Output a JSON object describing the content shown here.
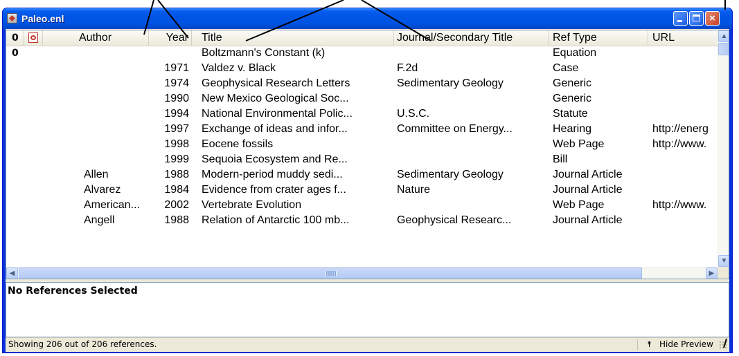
{
  "window": {
    "title": "Paleo.enl",
    "icon": "endnote-library-icon",
    "controls": {
      "minimize": "minimize",
      "maximize": "maximize",
      "close": "close"
    }
  },
  "columns": {
    "attachment_icon": "paperclip-icon",
    "attachment_glyph": "0",
    "pdf_icon": "pdf-icon",
    "author": "Author",
    "year": "Year",
    "title": "Title",
    "journal": "Journal/Secondary Title",
    "ref_type": "Ref Type",
    "url": "URL"
  },
  "rows": [
    {
      "attach": "0",
      "author": "",
      "year": "",
      "title": "Boltzmann's Constant (k)",
      "journal": "",
      "ref_type": "Equation",
      "url": ""
    },
    {
      "attach": "",
      "author": "",
      "year": "1971",
      "title": "Valdez v. Black",
      "journal": "F.2d",
      "ref_type": "Case",
      "url": ""
    },
    {
      "attach": "",
      "author": "",
      "year": "1974",
      "title": "Geophysical Research Letters",
      "journal": "Sedimentary Geology",
      "ref_type": "Generic",
      "url": ""
    },
    {
      "attach": "",
      "author": "",
      "year": "1990",
      "title": "New Mexico Geological Soc...",
      "journal": "",
      "ref_type": "Generic",
      "url": ""
    },
    {
      "attach": "",
      "author": "",
      "year": "1994",
      "title": "National Environmental Polic...",
      "journal": "U.S.C.",
      "ref_type": "Statute",
      "url": ""
    },
    {
      "attach": "",
      "author": "",
      "year": "1997",
      "title": "Exchange of ideas and infor...",
      "journal": "Committee on Energy...",
      "ref_type": "Hearing",
      "url": "http://energ"
    },
    {
      "attach": "",
      "author": "",
      "year": "1998",
      "title": "Eocene fossils",
      "journal": "",
      "ref_type": "Web Page",
      "url": "http://www."
    },
    {
      "attach": "",
      "author": "",
      "year": "1999",
      "title": "Sequoia Ecosystem and Re...",
      "journal": "",
      "ref_type": "Bill",
      "url": ""
    },
    {
      "attach": "",
      "author": "Allen",
      "year": "1988",
      "title": "Modern-period muddy sedi...",
      "journal": "Sedimentary Geology",
      "ref_type": "Journal Article",
      "url": ""
    },
    {
      "attach": "",
      "author": "Alvarez",
      "year": "1984",
      "title": "Evidence from crater ages f...",
      "journal": "Nature",
      "ref_type": "Journal Article",
      "url": ""
    },
    {
      "attach": "",
      "author": "American...",
      "year": "2002",
      "title": "Vertebrate Evolution",
      "journal": "",
      "ref_type": "Web Page",
      "url": "http://www."
    },
    {
      "attach": "",
      "author": "Angell",
      "year": "1988",
      "title": "Relation of Antarctic 100 mb...",
      "journal": "Geophysical Researc...",
      "ref_type": "Journal Article",
      "url": ""
    }
  ],
  "scrollbars": {
    "up": "▲",
    "down": "▼",
    "left": "◀",
    "right": "▶"
  },
  "preview": {
    "text": "No References Selected"
  },
  "status": {
    "text": "Showing 206 out of 206 references.",
    "hide_preview_arrow": "⯭",
    "hide_preview_label": "Hide Preview"
  },
  "colors": {
    "titlebar": "#0054e3",
    "close_button": "#c8412a",
    "frame": "#0831d9",
    "chrome": "#ece9d8"
  }
}
